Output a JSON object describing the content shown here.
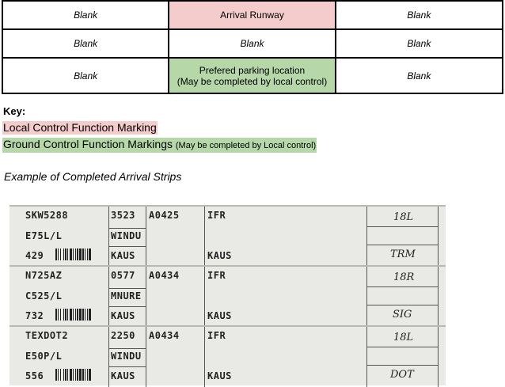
{
  "grid": {
    "row1": [
      "Blank",
      "Arrival Runway",
      "Blank"
    ],
    "row2": [
      "Blank",
      "Blank",
      "Blank"
    ],
    "row3_left": "Blank",
    "row3_center_line1": "Prefered parking location",
    "row3_center_line2": "(May be completed by local control)",
    "row3_right": "Blank"
  },
  "colors": {
    "local_control": "#f4cccc",
    "ground_control": "#b6d7a8"
  },
  "key": {
    "title": "Key:",
    "local": "Local Control Function Marking",
    "ground": "Ground Control Function Markings",
    "ground_note": "(May be completed by Local control)"
  },
  "example_title": "Example of Completed Arrival Strips",
  "strips": [
    {
      "callsign": "SKW5288",
      "type": "E75L/L",
      "cid": "429",
      "code": "3523",
      "fix": "WINDU",
      "dest": "KAUS",
      "time": "A0425",
      "rules": "IFR",
      "field": "KAUS",
      "runway": "18L",
      "parking": "TRM"
    },
    {
      "callsign": "N725AZ",
      "type": "C525/L",
      "cid": "732",
      "code": "0577",
      "fix": "MNURE",
      "dest": "KAUS",
      "time": "A0434",
      "rules": "IFR",
      "field": "KAUS",
      "runway": "18R",
      "parking": "SIG"
    },
    {
      "callsign": "TEXDOT2",
      "type": "E50P/L",
      "cid": "556",
      "code": "2250",
      "fix": "WINDU",
      "dest": "KAUS",
      "time": "A0434",
      "rules": "IFR",
      "field": "KAUS",
      "runway": "18L",
      "parking": "DOT"
    }
  ]
}
